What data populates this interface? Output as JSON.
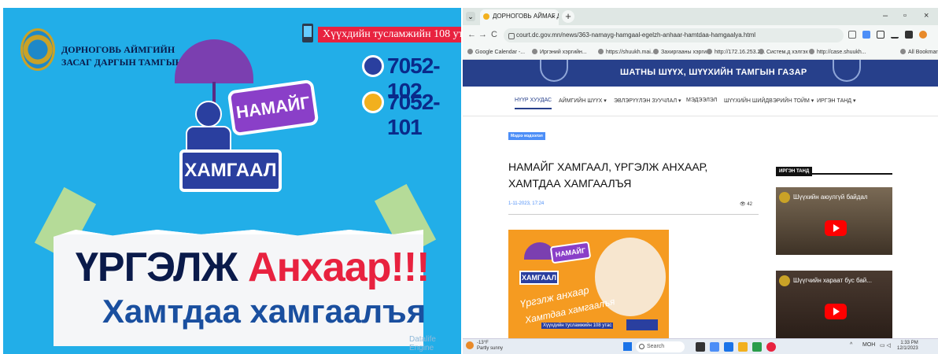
{
  "poster": {
    "org_line1": "ДОРНОГОВЬ АЙМГИЙН",
    "org_line2": "ЗАСАГ ДАРГЫН ТАМГЫН ГАЗАР",
    "hotline": "Хүүхдийн тусламжийн 108 утас",
    "phone1": "7052-102",
    "phone2": "7052-101",
    "bubble_top": "НАМАЙГ",
    "bubble_bottom": "ХАМГААЛ",
    "slogan_part1": "ҮРГЭЛЖ",
    "slogan_part2": "Анхаар!!!",
    "slogan_line2": "Хамтдаа хамгаалъя",
    "watermark": "Datalife Engine"
  },
  "browser": {
    "tab_title": "ДОРНОГОВЬ АЙМАГ ДАХЬ Ш",
    "tab_close": "×",
    "new_tab": "+",
    "url": "court.dc.gov.mn/news/363-namayg-hamgaal-egelzh-anhaar-hamtdaa-hamgaalya.html",
    "nav": {
      "back": "←",
      "forward": "→",
      "reload": "C"
    },
    "win": {
      "min": "–",
      "restore": "▫",
      "close": "×"
    },
    "bookmarks": [
      "Google Calendar -...",
      "Иргэний хэргийн...",
      "https://shuukh.mai...",
      "Захиргааны хэрги...",
      "http://172.16.253.2...",
      "Систем.д хэлгэх",
      "http://case.shuukh...",
      "All Bookmar"
    ],
    "site_title": "ШАТНЫ ШҮҮХ, ШҮҮХИЙН ТАМГЫН ГАЗАР",
    "menu": [
      {
        "label": "НҮҮР ХУУДАС",
        "active": true
      },
      {
        "label": "АЙМГИЙН ШҮҮХ ▾",
        "active": false
      },
      {
        "label": "ЭВЛЭРҮҮЛЭН ЗУУЧЛАЛ ▾",
        "active": false
      },
      {
        "label": "МЭДЭЭЛЭЛ",
        "active": false
      },
      {
        "label": "ШҮҮХИЙН ШИЙДВЭРИЙН ТОЙМ ▾",
        "active": false
      },
      {
        "label": "ИРГЭН ТАНД ▾",
        "active": false
      }
    ],
    "category": "Мэдээ мэдээлэл",
    "headline": "НАМАЙГ ХАМГААЛ, ҮРГЭЛЖ АНХААР, ХАМТДАА ХАМГААЛЪЯ",
    "date": "1-11-2023, 17:24",
    "views": "👁 42",
    "thumb": {
      "bubble_top": "НАМАЙГ",
      "bubble_bottom": "ХАМГААЛ",
      "script1": "Үргэлж анхаар",
      "script2": "Хамтдаа хамгаалъя",
      "hotline": "Хүүхдийн тусламжийн 108 утас"
    },
    "sidebar_heading": "ИРГЭН ТАНД",
    "videos": [
      {
        "title": "Шүүхийн аюулгүй байдал"
      },
      {
        "title": "Шүүгчийн хараат бус бай..."
      }
    ],
    "taskbar": {
      "weather_temp": "-13°F",
      "weather_desc": "Partly sunny",
      "search": "Search",
      "lang": "МОН",
      "time": "1:33 PM",
      "date": "12/1/2023"
    }
  },
  "colors": {
    "poster_bg": "#22aee8",
    "site_header": "#27408b",
    "accent_red": "#e8223f",
    "accent_purple": "#7b3fb0"
  }
}
